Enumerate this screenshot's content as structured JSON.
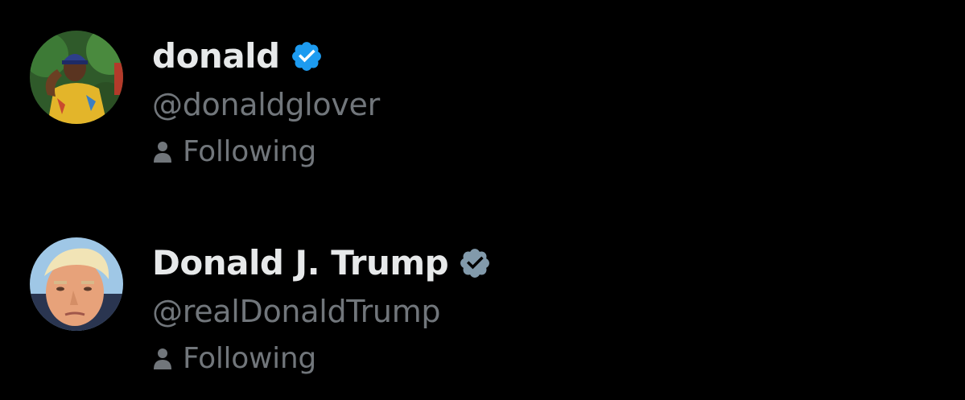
{
  "accounts": [
    {
      "name": "donald",
      "handle": "@donaldglover",
      "status": "Following",
      "verified_icon": "verified-badge-icon",
      "badge_color": "#1d9bf0",
      "avatar_icon": "avatar-photo"
    },
    {
      "name": "Donald J. Trump",
      "handle": "@realDonaldTrump",
      "status": "Following",
      "verified_icon": "verified-badge-icon",
      "badge_color": "#829aab",
      "avatar_icon": "avatar-photo"
    }
  ],
  "colors": {
    "background": "#000000",
    "primary_text": "#e7e9ea",
    "secondary_text": "#71767b"
  }
}
